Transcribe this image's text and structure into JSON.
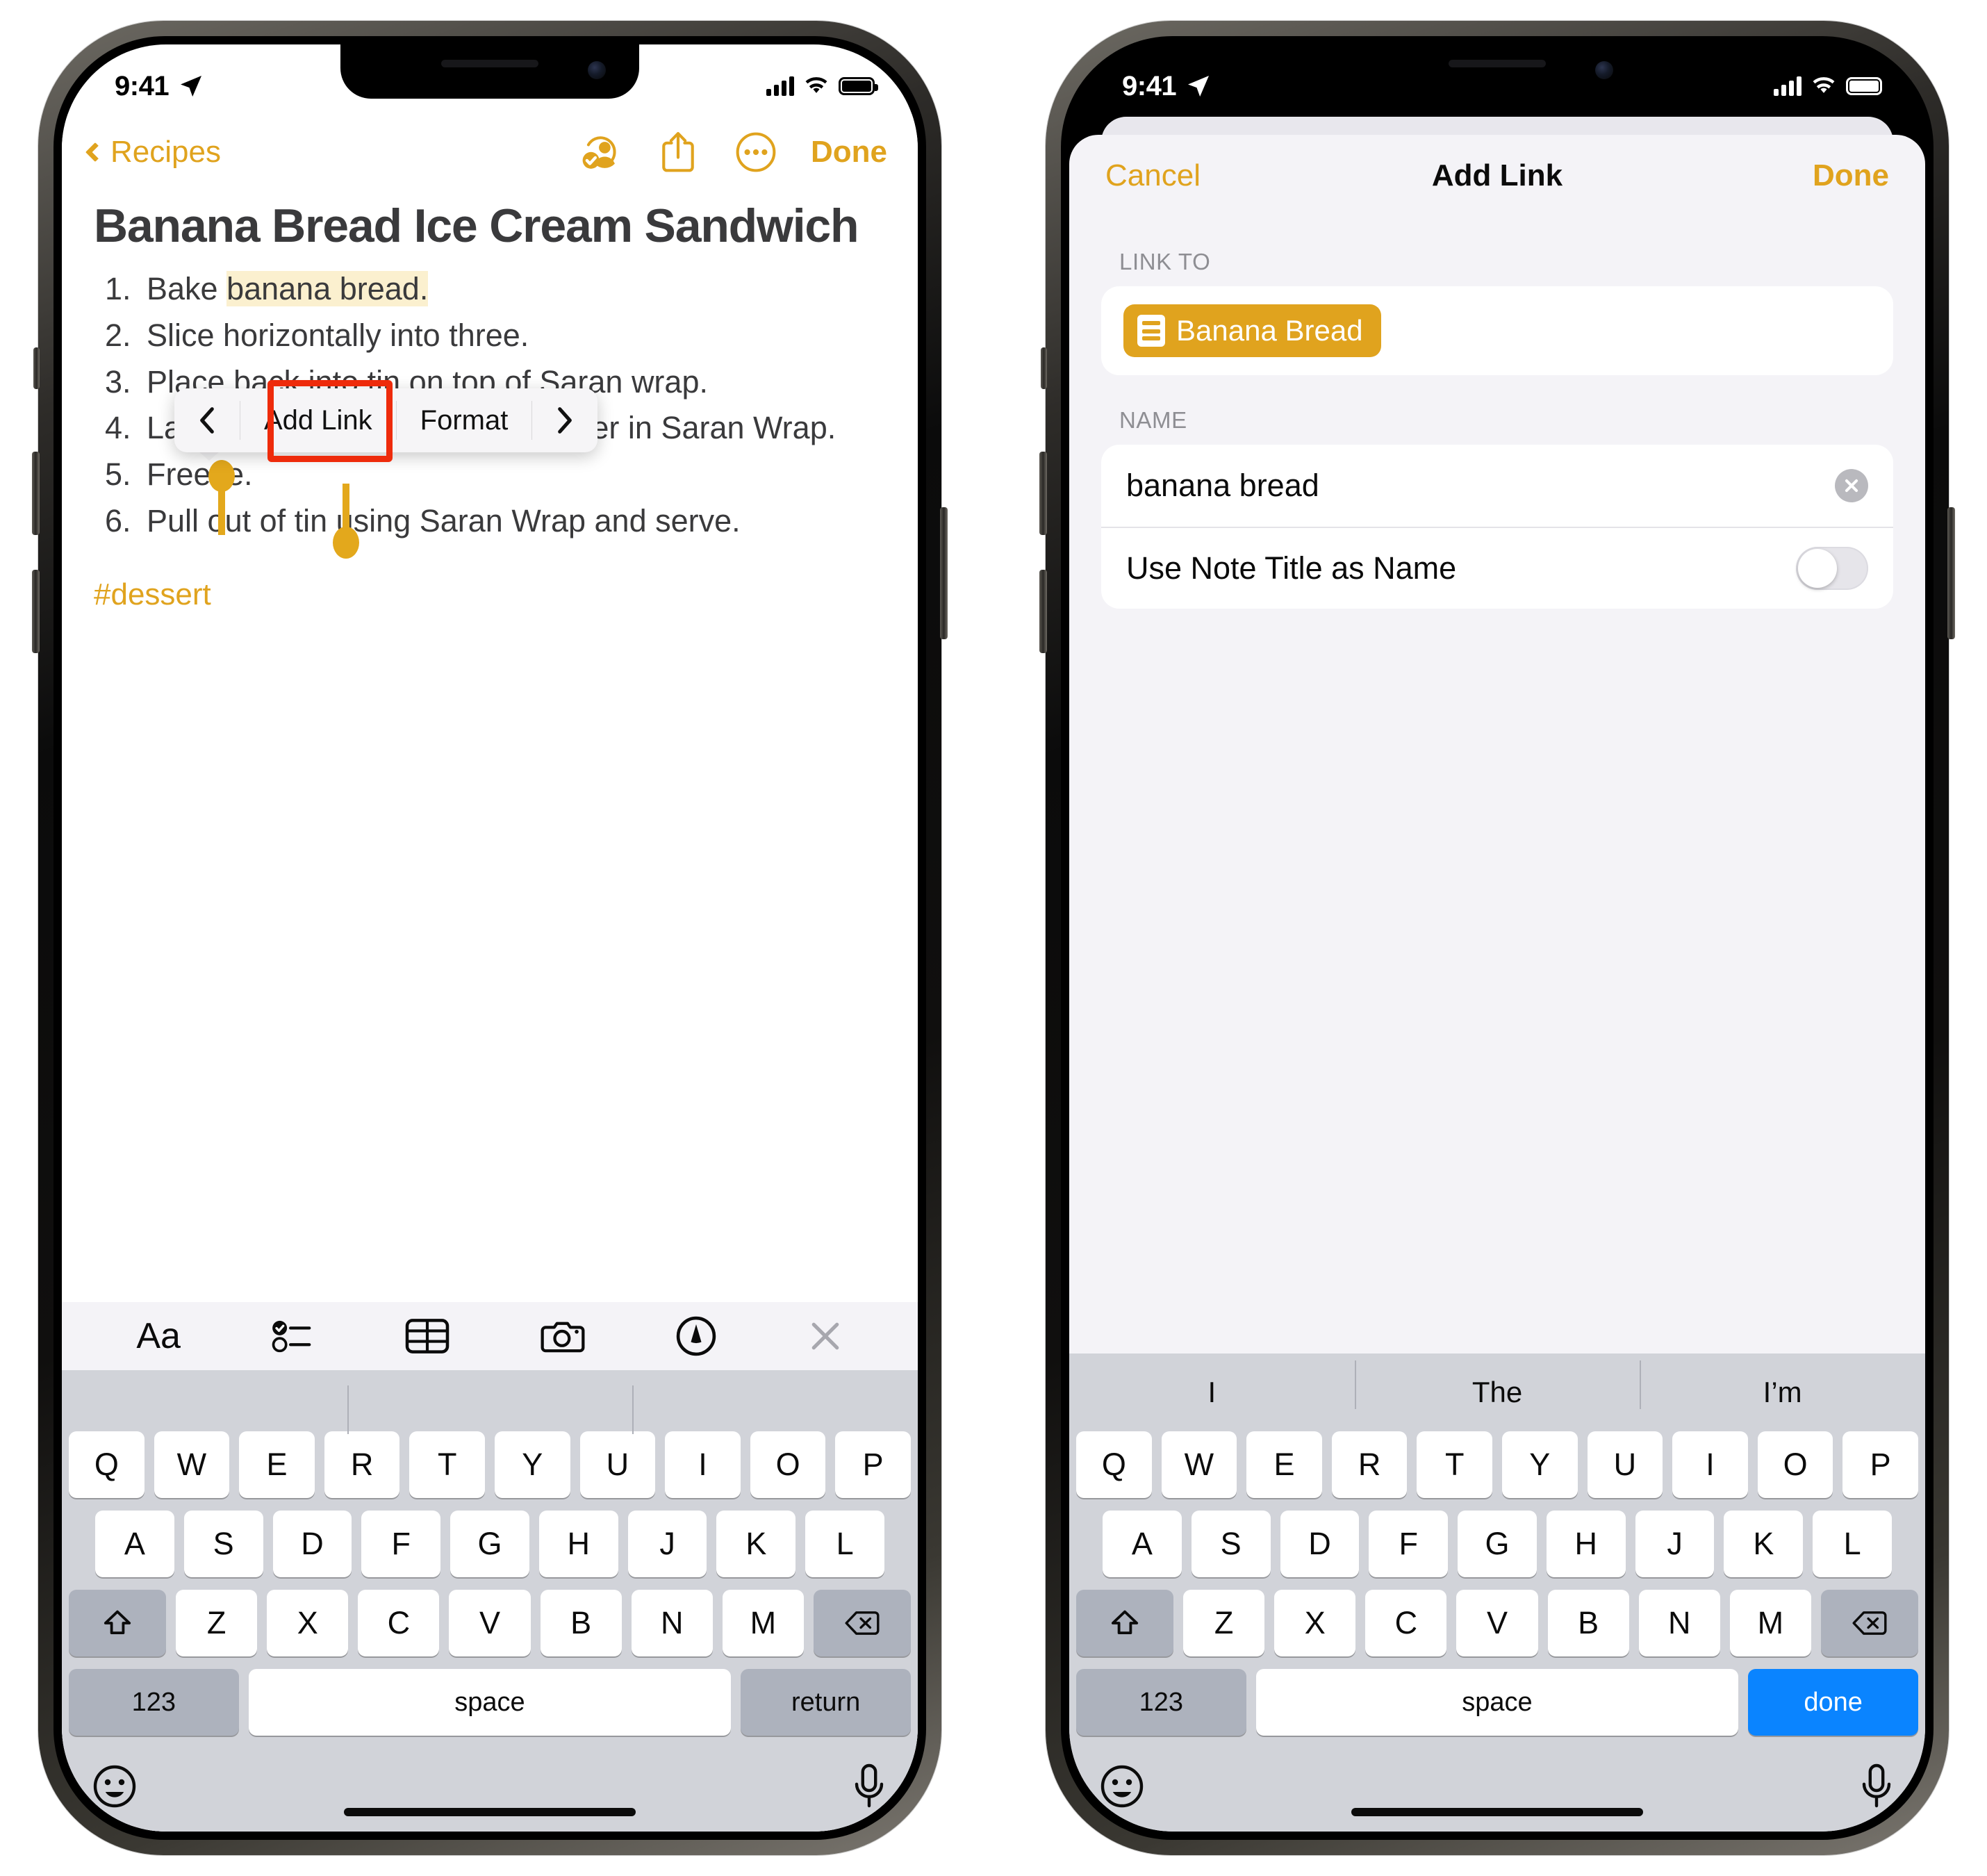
{
  "status_bar": {
    "time": "9:41",
    "location_icon": "location-arrow-icon",
    "signal_icon": "cellular-bars-icon",
    "wifi_icon": "wifi-icon",
    "battery_icon": "battery-icon"
  },
  "left_phone": {
    "nav": {
      "back_label": "Recipes",
      "back_icon": "chevron-left-icon",
      "collab_icon": "add-people-icon",
      "share_icon": "share-icon",
      "more_icon": "more-circle-icon",
      "done_label": "Done"
    },
    "note": {
      "title": "Banana Bread Ice Cream Sandwich",
      "steps": [
        {
          "pre": "Bake ",
          "highlight": "banana bread.",
          "post": ""
        },
        {
          "pre": "Slice horizontally into three.",
          "highlight": "",
          "post": ""
        },
        {
          "pre": "Place back into tin on top of Saran wrap.",
          "highlight": "",
          "post": ""
        },
        {
          "pre": "Layer vanilla and chocolate; cover in Saran Wrap.",
          "highlight": "",
          "post": ""
        },
        {
          "pre": "Freeze.",
          "highlight": "",
          "post": ""
        },
        {
          "pre": "Pull out of tin using Saran Wrap and serve.",
          "highlight": "",
          "post": ""
        }
      ],
      "tag": "#dessert"
    },
    "popup": {
      "prev_icon": "chevron-left-icon",
      "items": [
        "Add Link",
        "Format"
      ],
      "next_icon": "chevron-right-icon",
      "highlighted_item": "Add Link",
      "highlight_color": "#EE2B0B"
    },
    "format_toolbar": {
      "items": [
        {
          "name": "text-format-icon",
          "label": "Aa"
        },
        {
          "name": "checklist-icon",
          "label": ""
        },
        {
          "name": "table-icon",
          "label": ""
        },
        {
          "name": "camera-icon",
          "label": ""
        },
        {
          "name": "markup-pen-icon",
          "label": ""
        },
        {
          "name": "close-icon",
          "label": ""
        }
      ]
    },
    "keyboard": {
      "row1": [
        "Q",
        "W",
        "E",
        "R",
        "T",
        "Y",
        "U",
        "I",
        "O",
        "P"
      ],
      "row2": [
        "A",
        "S",
        "D",
        "F",
        "G",
        "H",
        "J",
        "K",
        "L"
      ],
      "row3": [
        "Z",
        "X",
        "C",
        "V",
        "B",
        "N",
        "M"
      ],
      "shift_icon": "shift-icon",
      "backspace_icon": "backspace-icon",
      "numbers_label": "123",
      "space_label": "space",
      "action_label": "return",
      "emoji_icon": "emoji-icon",
      "mic_icon": "microphone-icon"
    }
  },
  "right_phone": {
    "sheet": {
      "cancel_label": "Cancel",
      "title": "Add Link",
      "done_label": "Done",
      "link_to_label": "LINK TO",
      "link_chip": {
        "icon": "note-doc-icon",
        "label": "Banana Bread"
      },
      "name_label": "NAME",
      "name_value": "banana bread",
      "name_clear_icon": "clear-text-icon",
      "use_title_label": "Use Note Title as Name",
      "use_title_enabled": false
    },
    "keyboard": {
      "predictions": [
        "I",
        "The",
        "I’m"
      ],
      "row1": [
        "Q",
        "W",
        "E",
        "R",
        "T",
        "Y",
        "U",
        "I",
        "O",
        "P"
      ],
      "row2": [
        "A",
        "S",
        "D",
        "F",
        "G",
        "H",
        "J",
        "K",
        "L"
      ],
      "row3": [
        "Z",
        "X",
        "C",
        "V",
        "B",
        "N",
        "M"
      ],
      "shift_icon": "shift-icon",
      "backspace_icon": "backspace-icon",
      "numbers_label": "123",
      "space_label": "space",
      "action_label": "done",
      "emoji_icon": "emoji-icon",
      "mic_icon": "microphone-icon"
    }
  },
  "colors": {
    "accent": "#E0A31E",
    "highlight_box": "#EE2B0B",
    "selection_fill": "#FBF0CF",
    "blue_key": "#0A84FF"
  }
}
